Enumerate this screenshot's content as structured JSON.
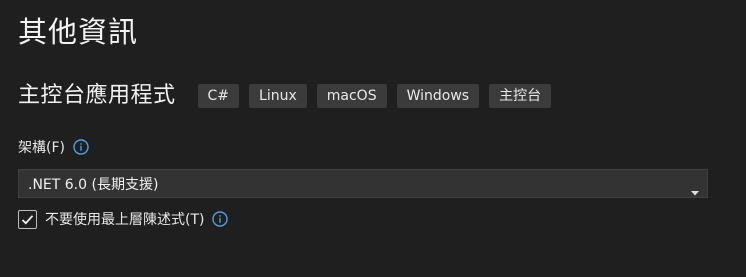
{
  "page": {
    "title": "其他資訊"
  },
  "template": {
    "name": "主控台應用程式",
    "tags": [
      "C#",
      "Linux",
      "macOS",
      "Windows",
      "主控台"
    ]
  },
  "framework": {
    "label": "架構(F)",
    "selected": ".NET 6.0 (長期支援)"
  },
  "top_level_statements": {
    "label": "不要使用最上層陳述式(T)",
    "checked": true
  },
  "icons": {
    "info": "info-icon",
    "dropdown": "chevron-down-icon",
    "check": "checkmark-icon"
  },
  "colors": {
    "background": "#1f1f1f",
    "tag_background": "#3b3b3b",
    "select_background": "#333333",
    "info_accent": "#4aa3df"
  }
}
